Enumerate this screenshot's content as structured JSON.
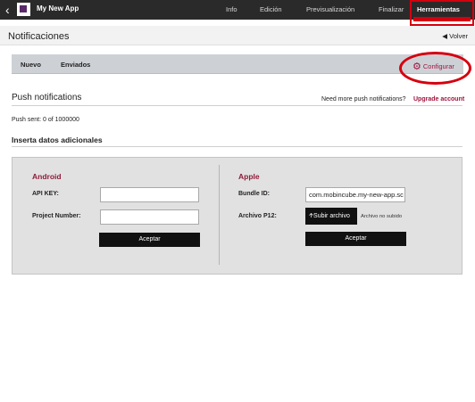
{
  "topbar": {
    "app_name": "My New App",
    "nav": [
      "Info",
      "Edición",
      "Previsualización",
      "Finalizar",
      "Herramientas"
    ]
  },
  "page": {
    "title": "Notificaciones",
    "back_label": "Volver"
  },
  "subnav": {
    "tabs": [
      "Nuevo",
      "Enviados"
    ],
    "configure_label": "Configurar"
  },
  "push": {
    "title": "Push notifications",
    "more_text": "Need more push notifications?",
    "upgrade_label": "Upgrade account",
    "sent_text": "Push sent: 0 of 1000000"
  },
  "extra": {
    "title": "Inserta datos adicionales"
  },
  "android": {
    "title": "Android",
    "api_key_label": "API KEY:",
    "api_key_value": "",
    "project_number_label": "Project Number:",
    "project_number_value": "",
    "accept_label": "Aceptar"
  },
  "apple": {
    "title": "Apple",
    "bundle_label": "Bundle ID:",
    "bundle_value": "com.mobincube.my-new-app.sc",
    "p12_label": "Archivo P12:",
    "upload_label": "Subir archivo",
    "no_file_text": "Archivo no subido",
    "accept_label": "Aceptar"
  },
  "colors": {
    "accent": "#a0153e",
    "highlight": "#d5000f",
    "topbar": "#2a2a2a"
  }
}
